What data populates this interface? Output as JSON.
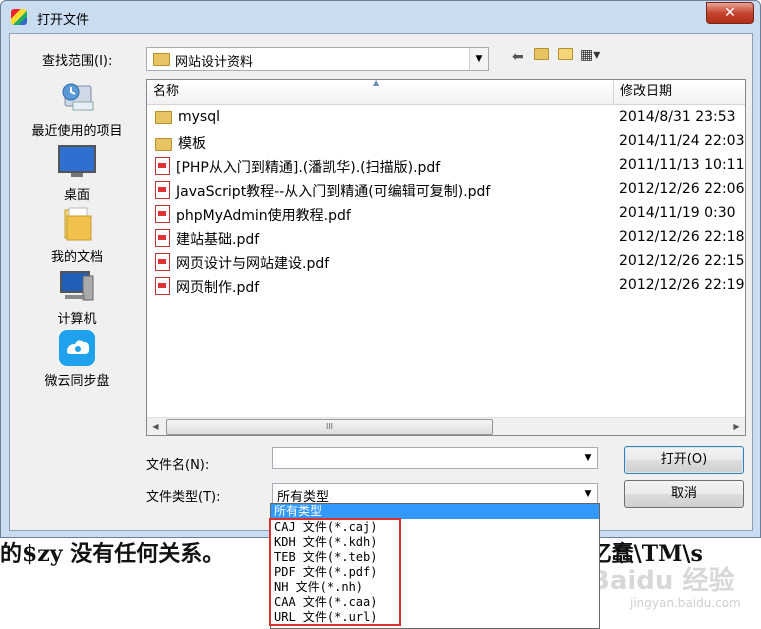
{
  "title": "打开文件",
  "close_glyph": "✕",
  "lookin": {
    "label": "查找范围(I):",
    "value": "网站设计资料"
  },
  "places": [
    {
      "label": "最近使用的项目",
      "icon": "recent-places-icon"
    },
    {
      "label": "桌面",
      "icon": "desktop-icon"
    },
    {
      "label": "我的文档",
      "icon": "documents-icon"
    },
    {
      "label": "计算机",
      "icon": "computer-icon"
    },
    {
      "label": "微云同步盘",
      "icon": "weiyun-icon"
    }
  ],
  "columns": {
    "name": "名称",
    "date": "修改日期"
  },
  "files": [
    {
      "name": "mysql",
      "date": "2014/8/31 23:53",
      "kind": "folder"
    },
    {
      "name": "模板",
      "date": "2014/11/24 22:03",
      "kind": "folder"
    },
    {
      "name": "[PHP从入门到精通].(潘凯华).(扫描版).pdf",
      "date": "2011/11/13 10:11",
      "kind": "pdf"
    },
    {
      "name": "JavaScript教程--从入门到精通(可编辑可复制).pdf",
      "date": "2012/12/26 22:06",
      "kind": "pdf"
    },
    {
      "name": "phpMyAdmin使用教程.pdf",
      "date": "2014/11/19 0:30",
      "kind": "pdf"
    },
    {
      "name": "建站基础.pdf",
      "date": "2012/12/26 22:18",
      "kind": "pdf"
    },
    {
      "name": "网页设计与网站建设.pdf",
      "date": "2012/12/26 22:15",
      "kind": "pdf"
    },
    {
      "name": "网页制作.pdf",
      "date": "2012/12/26 22:19",
      "kind": "pdf"
    }
  ],
  "scroll_thumb_glyph": "III",
  "filename": {
    "label": "文件名(N):",
    "value": ""
  },
  "filetype": {
    "label": "文件类型(T):",
    "value": "所有类型"
  },
  "buttons": {
    "open": "打开(O)",
    "cancel": "取消"
  },
  "filetype_options": [
    "所有类型",
    "CAJ 文件(*.caj)",
    "KDH 文件(*.kdh)",
    "TEB 文件(*.teb)",
    "PDF 文件(*.pdf)",
    "NH 文件(*.nh)",
    "CAA 文件(*.caa)",
    "URL 文件(*.url)"
  ],
  "background_text": {
    "left": "的$zy 没有任何关系。",
    "right": "：  忆蠢\\TM\\s"
  },
  "watermark": {
    "main": "Baidu 经验",
    "sub": "jingyan.baidu.com"
  },
  "colors": {
    "selection": "#3399ff",
    "highlight": "#d93030",
    "titlebar": "#c9dcf0"
  }
}
